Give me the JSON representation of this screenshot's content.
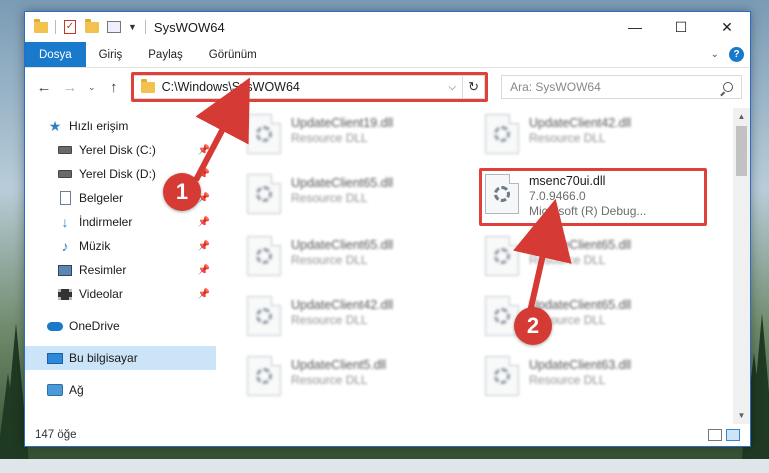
{
  "window": {
    "title": "SysWOW64",
    "controls": {
      "minimize": "—",
      "maximize": "☐",
      "close": "✕"
    }
  },
  "ribbon": {
    "tabs": [
      {
        "label": "Dosya",
        "active": true
      },
      {
        "label": "Giriş"
      },
      {
        "label": "Paylaş"
      },
      {
        "label": "Görünüm"
      }
    ],
    "expand_icon": "chevron-down-icon",
    "help_label": "?"
  },
  "nav": {
    "back": "←",
    "forward": "→",
    "recent": "⌄",
    "up": "↑",
    "address_path": "C:\\Windows\\SysWOW64",
    "search_placeholder": "Ara: SysWOW64"
  },
  "sidebar": {
    "items": [
      {
        "label": "Hızlı erişim",
        "icon": "star-icon"
      },
      {
        "label": "Yerel Disk (C:)",
        "icon": "disk-icon",
        "pinned": true
      },
      {
        "label": "Yerel Disk (D:)",
        "icon": "disk-icon",
        "pinned": true
      },
      {
        "label": "Belgeler",
        "icon": "document-icon",
        "pinned": true
      },
      {
        "label": "İndirmeler",
        "icon": "download-icon",
        "pinned": true
      },
      {
        "label": "Müzik",
        "icon": "music-icon",
        "pinned": true
      },
      {
        "label": "Resimler",
        "icon": "pictures-icon",
        "pinned": true
      },
      {
        "label": "Videolar",
        "icon": "videos-icon",
        "pinned": true
      },
      {
        "label": "OneDrive",
        "icon": "cloud-icon"
      },
      {
        "label": "Bu bilgisayar",
        "icon": "computer-icon",
        "selected": true
      },
      {
        "label": "Ağ",
        "icon": "network-icon"
      }
    ]
  },
  "files": [
    {
      "name": "UpdateClient19.dll",
      "type": "Resource DLL"
    },
    {
      "name": "UpdateClient42.dll",
      "type": "Resource DLL"
    },
    {
      "name": "UpdateClient65.dll",
      "type": "Resource DLL"
    },
    {
      "name": "msenc70ui.dll",
      "version": "7.0.9466.0",
      "description": "Microsoft (R) Debug..."
    },
    {
      "name": "UpdateClient65.dll",
      "type": "Resource DLL"
    },
    {
      "name": "UpdateClient65.dll",
      "type": "Resource DLL"
    },
    {
      "name": "UpdateClient42.dll",
      "type": "Resource DLL"
    },
    {
      "name": "UpdateClient65.dll",
      "type": "Resource DLL"
    },
    {
      "name": "UpdateClient5.dll",
      "type": "Resource DLL"
    },
    {
      "name": "UpdateClient63.dll",
      "type": "Resource DLL"
    }
  ],
  "status": {
    "item_count": "147 öğe"
  },
  "callouts": {
    "one": "1",
    "two": "2"
  },
  "colors": {
    "accent": "#1979ca",
    "highlight": "#e0403a",
    "callout": "#d63a34"
  }
}
